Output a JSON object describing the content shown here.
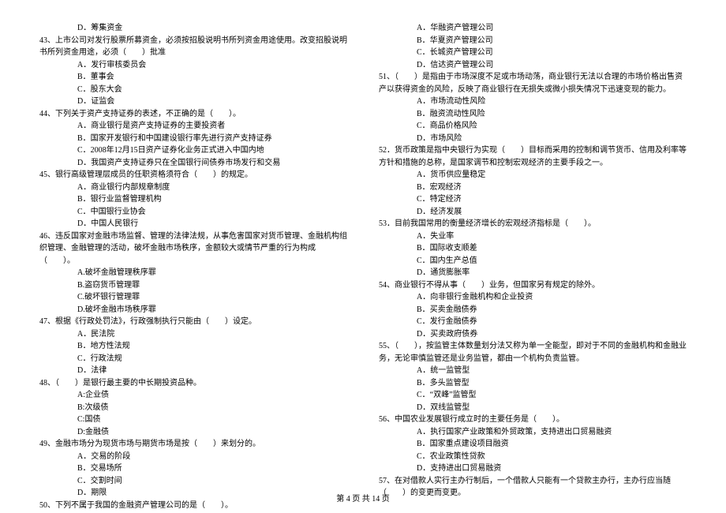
{
  "left": {
    "q42_d": "D．筹集资金",
    "q43": "43、上市公司对发行股票所募资金，必须按招股说明书所列资金用途使用。改变招股说明书所列资金用途，必须（　　）批准",
    "q43_a": "A．发行审核委员会",
    "q43_b": "B．董事会",
    "q43_c": "C．股东大会",
    "q43_d": "D．证监会",
    "q44": "44、下列关于资产支持证券的表述，不正确的是（　　）。",
    "q44_a": "A．商业银行是资产支持证券的主要投资者",
    "q44_b": "B．国家开发银行和中国建设银行率先进行资产支持证券",
    "q44_c": "C．2008年12月15日资产证券化业务正式进入中国内地",
    "q44_d": "D．我国资产支持证券只在全国银行间债券市场发行和交易",
    "q45": "45、银行高级管理层成员的任职资格须符合（　　）的规定。",
    "q45_a": "A．商业银行内部规章制度",
    "q45_b": "B．银行业监督管理机构",
    "q45_c": "C．中国银行业协会",
    "q45_d": "D．中国人民银行",
    "q46": "46、违反国家对金融市场监督、管理的法律法规，从事危害国家对货币管理、金融机构组织管理、金融管理的活动，破坏金融市场秩序，金额较大或情节严重的行为构成（　　）。",
    "q46_a": "A.破坏金融管理秩序罪",
    "q46_b": "B.盗窃货币管理罪",
    "q46_c": "C.破坏银行管理罪",
    "q46_d": "D.破坏金融市场秩序罪",
    "q47": "47、根据《行政处罚法》，行政强制执行只能由（　　）设定。",
    "q47_a": "A．民法院",
    "q47_b": "B．地方性法规",
    "q47_c": "C．行政法规",
    "q47_d": "D．法律",
    "q48": "48、（　　）是银行最主要的中长期投资品种。",
    "q48_a": "A:企业债",
    "q48_b": "B:次级债",
    "q48_c": "C:国债",
    "q48_d": "D:金融债",
    "q49": "49、金融市场分为现货市场与期货市场是按（　　）来划分的。",
    "q49_a": "A．交易的阶段",
    "q49_b": "B．交易场所",
    "q49_c": "C．交割时间",
    "q49_d": "D．期限",
    "q50": "50、下列不属于我国的金融资产管理公司的是（　　）。"
  },
  "right": {
    "q50_a": "A．华融资产管理公司",
    "q50_b": "B．华夏资产管理公司",
    "q50_c": "C．长城资产管理公司",
    "q50_d": "D．信达资产管理公司",
    "q51": "51、（　　）是指由于市场深度不足或市场动荡，商业银行无法以合理的市场价格出售资产以获得资金的风险，反映了商业银行在无损失或微小损失情况下迅速变现的能力。",
    "q51_a": "A．市场流动性风险",
    "q51_b": "B．融资流动性风险",
    "q51_c": "C．商品价格风险",
    "q51_d": "D．市场风险",
    "q52": "52．货币政策是指中央银行为实现（　　）目标而采用的控制和调节货币、信用及利率等方针和措施的总称，是国家调节和控制宏观经济的主要手段之一。",
    "q52_a": "A．货币供应量稳定",
    "q52_b": "B．宏观经济",
    "q52_c": "C．特定经济",
    "q52_d": "D．经济发展",
    "q53": "53．目前我国常用的衡量经济增长的宏观经济指标是（　　）。",
    "q53_a": "A．失业率",
    "q53_b": "B．国际收支顺差",
    "q53_c": "C．国内生产总值",
    "q53_d": "D．通货膨胀率",
    "q54": "54、商业银行不得从事（　　）业务，但国家另有规定的除外。",
    "q54_a": "A．向非银行金融机构和企业投资",
    "q54_b": "B．买卖金融债券",
    "q54_c": "C．发行金融债券",
    "q54_d": "D．买卖政府债券",
    "q55": "55、（　　），按监管主体数量划分法又称为单一全能型，即对于不同的金融机构和金融业务，无论审慎监管还是业务监管，都由一个机构负责监管。",
    "q55_a": "A．统一监管型",
    "q55_b": "B．多头监管型",
    "q55_c": "C．“双峰”监管型",
    "q55_d": "D．双线监管型",
    "q56": "56、中国农业发展银行成立时的主要任务是（　　）。",
    "q56_a": "A．执行国家产业政策和外贸政策，支持进出口贸易融资",
    "q56_b": "B．国家重点建设项目融资",
    "q56_c": "C．农业政策性贷款",
    "q56_d": "D．支持进出口贸易融资",
    "q57": "57、在对借款人实行主办行制后，一个借款人只能有一个贷款主办行，主办行应当随（　　）的变更而变更。"
  },
  "footer": "第 4 页 共 14 页"
}
